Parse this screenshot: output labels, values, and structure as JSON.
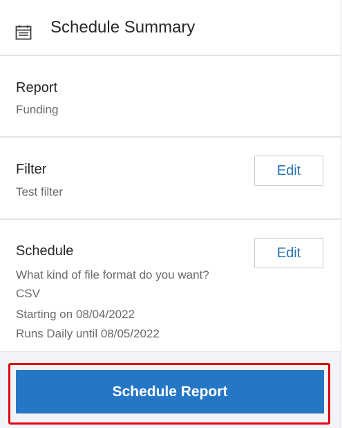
{
  "header": {
    "title": "Schedule Summary",
    "icon": "calendar-summary-icon"
  },
  "report": {
    "heading": "Report",
    "value": "Funding"
  },
  "filter": {
    "heading": "Filter",
    "value": "Test filter",
    "edit_label": "Edit"
  },
  "schedule": {
    "heading": "Schedule",
    "lines": [
      "What kind of file format do you want?",
      "CSV",
      "Starting on 08/04/2022",
      "Runs Daily until 08/05/2022"
    ],
    "edit_label": "Edit"
  },
  "footer": {
    "schedule_button_label": "Schedule Report"
  },
  "colors": {
    "accent": "#2577c6",
    "link": "#2a72b5",
    "highlight": "#e0000f",
    "footer_bg": "#f3f4f8"
  }
}
